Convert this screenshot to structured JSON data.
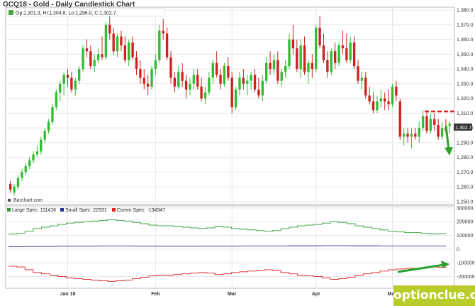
{
  "title": "GCQ18 - Gold - Daily Candlestick Chart",
  "ohlc_label": "Op:1,301.3, Hi:1,304.8, Lo:1,296.0, C:1,302.7",
  "last_price": "1,302.7",
  "credit": "Barchart.com",
  "watermark": "optionclue.com",
  "colors": {
    "up": "#33bb33",
    "down": "#cc2222",
    "grid": "#e6e6e6",
    "large": "#2e9a2e",
    "small": "#2a2a99",
    "comm": "#dd2222",
    "annotation_arrow": "#2aa02a",
    "annotation_line": "#e02020",
    "price_tag": "#333333"
  },
  "chart_data": [
    {
      "type": "candlestick",
      "y_ticks": [
        "1,250.0",
        "1,260.0",
        "1,270.0",
        "1,280.0",
        "1,290.0",
        "1,300.0",
        "1,310.0",
        "1,320.0",
        "1,330.0",
        "1,340.0",
        "1,350.0",
        "1,360.0",
        "1,370.0",
        "1,380.0"
      ],
      "ylim": [
        1248,
        1382
      ],
      "x_ticks": [
        "Jan 18",
        "Feb",
        "Mar",
        "Apr",
        "May"
      ],
      "x_tick_index": [
        15,
        38,
        58,
        80,
        100
      ],
      "candles": [
        {
          "o": 1262.0,
          "h": 1264.0,
          "l": 1256.0,
          "c": 1258.0
        },
        {
          "o": 1256.0,
          "h": 1262.0,
          "l": 1254.0,
          "c": 1260.0
        },
        {
          "o": 1260.0,
          "h": 1268.0,
          "l": 1258.0,
          "c": 1266.0
        },
        {
          "o": 1266.0,
          "h": 1272.0,
          "l": 1264.0,
          "c": 1270.0
        },
        {
          "o": 1270.0,
          "h": 1276.0,
          "l": 1268.0,
          "c": 1274.0
        },
        {
          "o": 1274.0,
          "h": 1280.0,
          "l": 1272.0,
          "c": 1278.0
        },
        {
          "o": 1278.0,
          "h": 1284.0,
          "l": 1276.0,
          "c": 1282.0
        },
        {
          "o": 1282.0,
          "h": 1288.0,
          "l": 1280.0,
          "c": 1284.0
        },
        {
          "o": 1284.0,
          "h": 1294.0,
          "l": 1282.0,
          "c": 1292.0
        },
        {
          "o": 1292.0,
          "h": 1300.0,
          "l": 1290.0,
          "c": 1298.0
        },
        {
          "o": 1298.0,
          "h": 1306.0,
          "l": 1296.0,
          "c": 1304.0
        },
        {
          "o": 1304.0,
          "h": 1316.0,
          "l": 1302.0,
          "c": 1314.0
        },
        {
          "o": 1314.0,
          "h": 1326.0,
          "l": 1312.0,
          "c": 1324.0
        },
        {
          "o": 1324.0,
          "h": 1332.0,
          "l": 1318.0,
          "c": 1330.0
        },
        {
          "o": 1330.0,
          "h": 1338.0,
          "l": 1322.0,
          "c": 1336.0
        },
        {
          "o": 1336.0,
          "h": 1340.0,
          "l": 1328.0,
          "c": 1334.0
        },
        {
          "o": 1334.0,
          "h": 1338.0,
          "l": 1324.0,
          "c": 1326.0
        },
        {
          "o": 1326.0,
          "h": 1334.0,
          "l": 1322.0,
          "c": 1332.0
        },
        {
          "o": 1332.0,
          "h": 1342.0,
          "l": 1330.0,
          "c": 1340.0
        },
        {
          "o": 1340.0,
          "h": 1356.0,
          "l": 1338.0,
          "c": 1354.0
        },
        {
          "o": 1354.0,
          "h": 1360.0,
          "l": 1348.0,
          "c": 1352.0
        },
        {
          "o": 1352.0,
          "h": 1356.0,
          "l": 1340.0,
          "c": 1342.0
        },
        {
          "o": 1342.0,
          "h": 1350.0,
          "l": 1338.0,
          "c": 1346.0
        },
        {
          "o": 1346.0,
          "h": 1354.0,
          "l": 1344.0,
          "c": 1350.0
        },
        {
          "o": 1350.0,
          "h": 1362.0,
          "l": 1346.0,
          "c": 1348.0
        },
        {
          "o": 1348.0,
          "h": 1372.0,
          "l": 1346.0,
          "c": 1370.0
        },
        {
          "o": 1370.0,
          "h": 1378.0,
          "l": 1360.0,
          "c": 1364.0
        },
        {
          "o": 1364.0,
          "h": 1368.0,
          "l": 1350.0,
          "c": 1352.0
        },
        {
          "o": 1352.0,
          "h": 1364.0,
          "l": 1348.0,
          "c": 1362.0
        },
        {
          "o": 1362.0,
          "h": 1366.0,
          "l": 1352.0,
          "c": 1356.0
        },
        {
          "o": 1356.0,
          "h": 1362.0,
          "l": 1344.0,
          "c": 1346.0
        },
        {
          "o": 1346.0,
          "h": 1360.0,
          "l": 1342.0,
          "c": 1358.0
        },
        {
          "o": 1358.0,
          "h": 1362.0,
          "l": 1346.0,
          "c": 1348.0
        },
        {
          "o": 1348.0,
          "h": 1352.0,
          "l": 1336.0,
          "c": 1340.0
        },
        {
          "o": 1340.0,
          "h": 1346.0,
          "l": 1330.0,
          "c": 1334.0
        },
        {
          "o": 1334.0,
          "h": 1340.0,
          "l": 1326.0,
          "c": 1330.0
        },
        {
          "o": 1330.0,
          "h": 1336.0,
          "l": 1322.0,
          "c": 1328.0
        },
        {
          "o": 1328.0,
          "h": 1342.0,
          "l": 1326.0,
          "c": 1340.0
        },
        {
          "o": 1340.0,
          "h": 1350.0,
          "l": 1336.0,
          "c": 1346.0
        },
        {
          "o": 1346.0,
          "h": 1370.0,
          "l": 1344.0,
          "c": 1366.0
        },
        {
          "o": 1366.0,
          "h": 1374.0,
          "l": 1360.0,
          "c": 1364.0
        },
        {
          "o": 1364.0,
          "h": 1368.0,
          "l": 1346.0,
          "c": 1348.0
        },
        {
          "o": 1348.0,
          "h": 1352.0,
          "l": 1330.0,
          "c": 1334.0
        },
        {
          "o": 1334.0,
          "h": 1338.0,
          "l": 1324.0,
          "c": 1328.0
        },
        {
          "o": 1328.0,
          "h": 1342.0,
          "l": 1326.0,
          "c": 1338.0
        },
        {
          "o": 1338.0,
          "h": 1344.0,
          "l": 1328.0,
          "c": 1332.0
        },
        {
          "o": 1332.0,
          "h": 1336.0,
          "l": 1320.0,
          "c": 1326.0
        },
        {
          "o": 1326.0,
          "h": 1334.0,
          "l": 1322.0,
          "c": 1330.0
        },
        {
          "o": 1330.0,
          "h": 1340.0,
          "l": 1326.0,
          "c": 1336.0
        },
        {
          "o": 1336.0,
          "h": 1340.0,
          "l": 1326.0,
          "c": 1328.0
        },
        {
          "o": 1328.0,
          "h": 1334.0,
          "l": 1318.0,
          "c": 1320.0
        },
        {
          "o": 1320.0,
          "h": 1328.0,
          "l": 1316.0,
          "c": 1324.0
        },
        {
          "o": 1324.0,
          "h": 1338.0,
          "l": 1322.0,
          "c": 1334.0
        },
        {
          "o": 1334.0,
          "h": 1346.0,
          "l": 1330.0,
          "c": 1344.0
        },
        {
          "o": 1344.0,
          "h": 1352.0,
          "l": 1334.0,
          "c": 1336.0
        },
        {
          "o": 1336.0,
          "h": 1340.0,
          "l": 1326.0,
          "c": 1330.0
        },
        {
          "o": 1330.0,
          "h": 1344.0,
          "l": 1328.0,
          "c": 1342.0
        },
        {
          "o": 1342.0,
          "h": 1348.0,
          "l": 1332.0,
          "c": 1334.0
        },
        {
          "o": 1334.0,
          "h": 1338.0,
          "l": 1310.0,
          "c": 1314.0
        },
        {
          "o": 1314.0,
          "h": 1328.0,
          "l": 1312.0,
          "c": 1326.0
        },
        {
          "o": 1326.0,
          "h": 1338.0,
          "l": 1322.0,
          "c": 1334.0
        },
        {
          "o": 1334.0,
          "h": 1340.0,
          "l": 1326.0,
          "c": 1330.0
        },
        {
          "o": 1330.0,
          "h": 1336.0,
          "l": 1322.0,
          "c": 1332.0
        },
        {
          "o": 1332.0,
          "h": 1338.0,
          "l": 1326.0,
          "c": 1336.0
        },
        {
          "o": 1336.0,
          "h": 1340.0,
          "l": 1324.0,
          "c": 1326.0
        },
        {
          "o": 1326.0,
          "h": 1334.0,
          "l": 1320.0,
          "c": 1322.0
        },
        {
          "o": 1322.0,
          "h": 1336.0,
          "l": 1318.0,
          "c": 1332.0
        },
        {
          "o": 1332.0,
          "h": 1348.0,
          "l": 1330.0,
          "c": 1344.0
        },
        {
          "o": 1344.0,
          "h": 1352.0,
          "l": 1336.0,
          "c": 1340.0
        },
        {
          "o": 1340.0,
          "h": 1350.0,
          "l": 1336.0,
          "c": 1346.0
        },
        {
          "o": 1346.0,
          "h": 1352.0,
          "l": 1330.0,
          "c": 1332.0
        },
        {
          "o": 1332.0,
          "h": 1340.0,
          "l": 1328.0,
          "c": 1338.0
        },
        {
          "o": 1338.0,
          "h": 1346.0,
          "l": 1334.0,
          "c": 1342.0
        },
        {
          "o": 1342.0,
          "h": 1364.0,
          "l": 1340.0,
          "c": 1360.0
        },
        {
          "o": 1360.0,
          "h": 1370.0,
          "l": 1350.0,
          "c": 1354.0
        },
        {
          "o": 1354.0,
          "h": 1360.0,
          "l": 1338.0,
          "c": 1340.0
        },
        {
          "o": 1340.0,
          "h": 1360.0,
          "l": 1334.0,
          "c": 1356.0
        },
        {
          "o": 1356.0,
          "h": 1362.0,
          "l": 1336.0,
          "c": 1338.0
        },
        {
          "o": 1338.0,
          "h": 1346.0,
          "l": 1330.0,
          "c": 1344.0
        },
        {
          "o": 1344.0,
          "h": 1350.0,
          "l": 1334.0,
          "c": 1340.0
        },
        {
          "o": 1340.0,
          "h": 1370.0,
          "l": 1338.0,
          "c": 1368.0
        },
        {
          "o": 1368.0,
          "h": 1376.0,
          "l": 1354.0,
          "c": 1356.0
        },
        {
          "o": 1356.0,
          "h": 1364.0,
          "l": 1344.0,
          "c": 1346.0
        },
        {
          "o": 1346.0,
          "h": 1352.0,
          "l": 1334.0,
          "c": 1338.0
        },
        {
          "o": 1338.0,
          "h": 1354.0,
          "l": 1336.0,
          "c": 1352.0
        },
        {
          "o": 1352.0,
          "h": 1358.0,
          "l": 1340.0,
          "c": 1344.0
        },
        {
          "o": 1344.0,
          "h": 1358.0,
          "l": 1342.0,
          "c": 1356.0
        },
        {
          "o": 1356.0,
          "h": 1366.0,
          "l": 1350.0,
          "c": 1354.0
        },
        {
          "o": 1354.0,
          "h": 1364.0,
          "l": 1344.0,
          "c": 1346.0
        },
        {
          "o": 1346.0,
          "h": 1362.0,
          "l": 1344.0,
          "c": 1358.0
        },
        {
          "o": 1358.0,
          "h": 1362.0,
          "l": 1340.0,
          "c": 1342.0
        },
        {
          "o": 1342.0,
          "h": 1346.0,
          "l": 1330.0,
          "c": 1332.0
        },
        {
          "o": 1332.0,
          "h": 1338.0,
          "l": 1326.0,
          "c": 1334.0
        },
        {
          "o": 1334.0,
          "h": 1338.0,
          "l": 1320.0,
          "c": 1322.0
        },
        {
          "o": 1322.0,
          "h": 1328.0,
          "l": 1316.0,
          "c": 1318.0
        },
        {
          "o": 1318.0,
          "h": 1324.0,
          "l": 1310.0,
          "c": 1312.0
        },
        {
          "o": 1312.0,
          "h": 1322.0,
          "l": 1310.0,
          "c": 1318.0
        },
        {
          "o": 1318.0,
          "h": 1326.0,
          "l": 1314.0,
          "c": 1320.0
        },
        {
          "o": 1320.0,
          "h": 1324.0,
          "l": 1312.0,
          "c": 1318.0
        },
        {
          "o": 1318.0,
          "h": 1326.0,
          "l": 1312.0,
          "c": 1316.0
        },
        {
          "o": 1316.0,
          "h": 1330.0,
          "l": 1314.0,
          "c": 1328.0
        },
        {
          "o": 1328.0,
          "h": 1332.0,
          "l": 1318.0,
          "c": 1322.0
        },
        {
          "o": 1318.0,
          "h": 1320.0,
          "l": 1292.0,
          "c": 1294.0
        },
        {
          "o": 1294.0,
          "h": 1300.0,
          "l": 1288.0,
          "c": 1296.0
        },
        {
          "o": 1296.0,
          "h": 1300.0,
          "l": 1290.0,
          "c": 1294.0
        },
        {
          "o": 1294.0,
          "h": 1300.0,
          "l": 1286.0,
          "c": 1296.0
        },
        {
          "o": 1296.0,
          "h": 1300.0,
          "l": 1292.0,
          "c": 1294.0
        },
        {
          "o": 1294.0,
          "h": 1304.0,
          "l": 1290.0,
          "c": 1300.0
        },
        {
          "o": 1300.0,
          "h": 1312.0,
          "l": 1298.0,
          "c": 1308.0
        },
        {
          "o": 1308.0,
          "h": 1312.0,
          "l": 1296.0,
          "c": 1298.0
        },
        {
          "o": 1298.0,
          "h": 1310.0,
          "l": 1296.0,
          "c": 1306.0
        },
        {
          "o": 1306.0,
          "h": 1310.0,
          "l": 1298.0,
          "c": 1302.0
        },
        {
          "o": 1302.0,
          "h": 1306.0,
          "l": 1292.0,
          "c": 1294.0
        },
        {
          "o": 1294.0,
          "h": 1304.0,
          "l": 1292.0,
          "c": 1300.0
        },
        {
          "o": 1300.0,
          "h": 1306.0,
          "l": 1296.0,
          "c": 1298.0
        },
        {
          "o": 1301.3,
          "h": 1304.8,
          "l": 1296.0,
          "c": 1302.7
        }
      ]
    },
    {
      "type": "line",
      "legend": [
        "Large Spec: 111416",
        "Small Spec: 22931",
        "Comm Spec: -134347"
      ],
      "y_ticks": [
        "300000",
        "200000",
        "100000",
        "0",
        "-100000",
        "-200000"
      ],
      "ylim": [
        -285000,
        315000
      ],
      "series": [
        {
          "name": "Large Spec",
          "values": [
            110000,
            115000,
            130000,
            150000,
            160000,
            170000,
            180000,
            190000,
            195000,
            200000,
            205000,
            210000,
            215000,
            210000,
            205000,
            195000,
            185000,
            175000,
            170000,
            170000,
            165000,
            160000,
            155000,
            150000,
            155000,
            165000,
            160000,
            150000,
            145000,
            140000,
            135000,
            130000,
            135000,
            150000,
            160000,
            170000,
            175000,
            180000,
            190000,
            200000,
            195000,
            185000,
            170000,
            160000,
            150000,
            140000,
            130000,
            125000,
            120000,
            120000,
            115000,
            110000,
            112000,
            111416
          ]
        },
        {
          "name": "Small Spec",
          "values": [
            18000,
            18000,
            19000,
            19000,
            20000,
            20000,
            21000,
            21000,
            22000,
            22000,
            22000,
            23000,
            23000,
            23000,
            23000,
            22000,
            22000,
            22000,
            21000,
            21000,
            21000,
            21000,
            21000,
            22000,
            22000,
            22000,
            22000,
            22000,
            23000,
            23000,
            23000,
            23000,
            23000,
            23000,
            24000,
            24000,
            24000,
            24000,
            25000,
            25000,
            25000,
            24000,
            24000,
            24000,
            24000,
            23000,
            23000,
            23000,
            23000,
            23000,
            23000,
            23000,
            23000,
            22931
          ]
        },
        {
          "name": "Comm Spec",
          "values": [
            -125000,
            -130000,
            -150000,
            -170000,
            -180000,
            -190000,
            -200000,
            -210000,
            -215000,
            -220000,
            -225000,
            -230000,
            -235000,
            -230000,
            -225000,
            -215000,
            -205000,
            -195000,
            -190000,
            -190000,
            -185000,
            -180000,
            -175000,
            -170000,
            -175000,
            -185000,
            -180000,
            -170000,
            -165000,
            -160000,
            -155000,
            -150000,
            -155000,
            -170000,
            -180000,
            -190000,
            -195000,
            -200000,
            -210000,
            -220000,
            -215000,
            -205000,
            -190000,
            -180000,
            -170000,
            -160000,
            -150000,
            -145000,
            -140000,
            -140000,
            -135000,
            -130000,
            -132000,
            -134347
          ]
        }
      ]
    }
  ]
}
